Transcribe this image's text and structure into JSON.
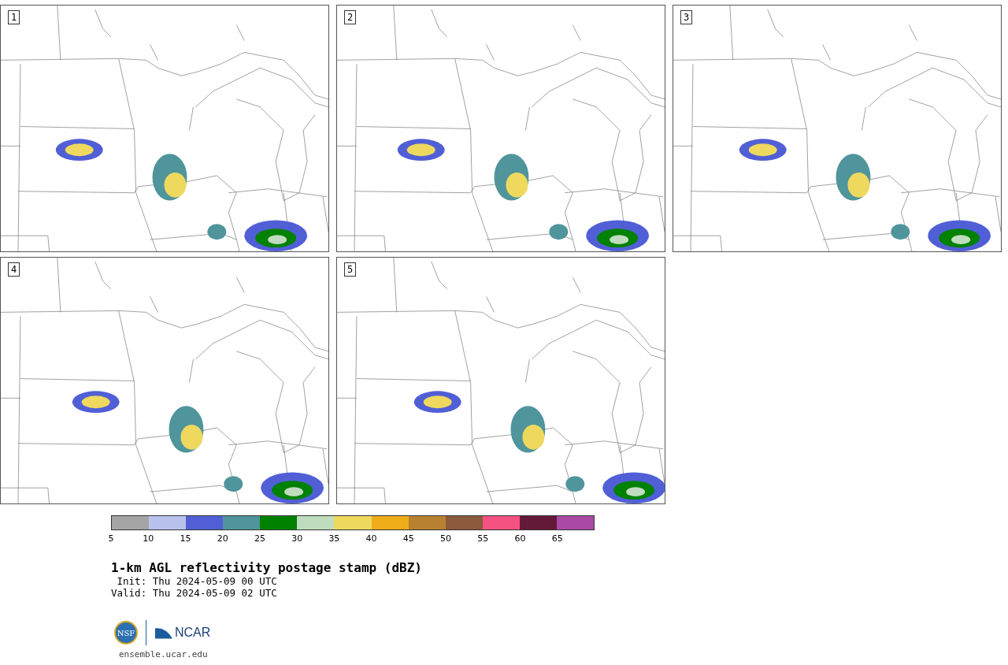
{
  "panels": [
    {
      "label": "1"
    },
    {
      "label": "2"
    },
    {
      "label": "3"
    },
    {
      "label": "4"
    },
    {
      "label": "5"
    }
  ],
  "colorbar": {
    "segments": [
      {
        "color": "#a5a5a5"
      },
      {
        "color": "#b8c2ec"
      },
      {
        "color": "#515fd6"
      },
      {
        "color": "#4f959b"
      },
      {
        "color": "#008100"
      },
      {
        "color": "#c0dcbf"
      },
      {
        "color": "#eed95e"
      },
      {
        "color": "#efad1a"
      },
      {
        "color": "#b88131"
      },
      {
        "color": "#8c5a3d"
      },
      {
        "color": "#f45280"
      },
      {
        "color": "#651938"
      },
      {
        "color": "#aa4aa6"
      }
    ],
    "ticks": [
      "5",
      "10",
      "15",
      "20",
      "25",
      "30",
      "35",
      "40",
      "45",
      "50",
      "55",
      "60",
      "65"
    ]
  },
  "title": "1-km AGL reflectivity postage stamp (dBZ)",
  "init": " Init: Thu 2024-05-09 00 UTC",
  "valid": "Valid: Thu 2024-05-09 02 UTC",
  "logos": {
    "nsf": "NSF",
    "ncar": "NCAR"
  },
  "url": "ensemble.ucar.edu"
}
